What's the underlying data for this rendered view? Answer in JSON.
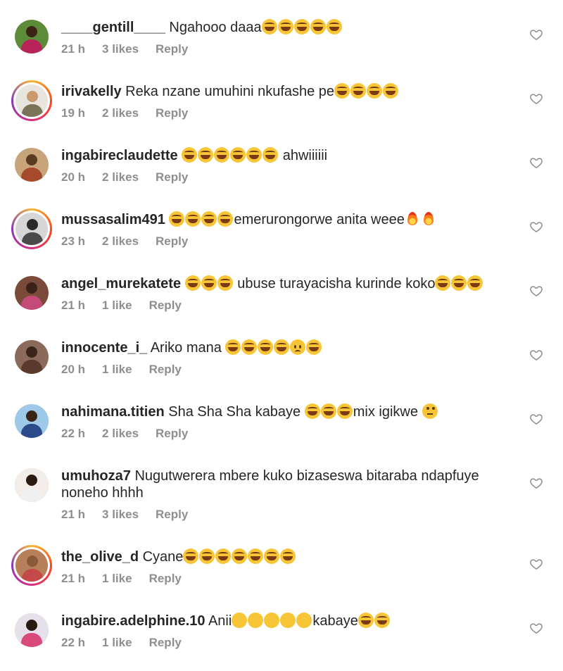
{
  "comments": [
    {
      "user": "____gentill____",
      "segments": [
        {
          "t": " Ngahooo daaa"
        },
        {
          "e": "laugh",
          "n": 5
        }
      ],
      "time": "21 h",
      "likes": "3 likes",
      "reply": "Reply",
      "ring": false,
      "avatar": {
        "bg": "#5c8b3a",
        "head": "#3a2416",
        "body": "#b8245a"
      }
    },
    {
      "user": "irivakelly",
      "segments": [
        {
          "t": " Reka nzane umuhini nkufashe pe"
        },
        {
          "e": "laugh",
          "n": 4
        }
      ],
      "time": "19 h",
      "likes": "2 likes",
      "reply": "Reply",
      "ring": true,
      "avatar": {
        "bg": "#e8e4de",
        "head": "#c89a6c",
        "body": "#7a7458"
      }
    },
    {
      "user": "ingabireclaudette",
      "segments": [
        {
          "t": " "
        },
        {
          "e": "laugh",
          "n": 6
        },
        {
          "t": " ahwiiiiii"
        }
      ],
      "time": "20 h",
      "likes": "2 likes",
      "reply": "Reply",
      "ring": false,
      "avatar": {
        "bg": "#c8a47a",
        "head": "#5a3b22",
        "body": "#a54a2a"
      }
    },
    {
      "user": "mussasalim491",
      "segments": [
        {
          "t": " "
        },
        {
          "e": "laugh",
          "n": 4
        },
        {
          "t": "emerurongorwe anita weee"
        },
        {
          "e": "fire",
          "n": 2
        }
      ],
      "time": "23 h",
      "likes": "2 likes",
      "reply": "Reply",
      "ring": true,
      "avatar": {
        "bg": "#d6d6d6",
        "head": "#2a2a2a",
        "body": "#4a4a4a"
      }
    },
    {
      "user": "angel_murekatete",
      "segments": [
        {
          "t": " "
        },
        {
          "e": "laugh",
          "n": 3
        },
        {
          "t": " ubuse turayacisha kurinde koko"
        },
        {
          "e": "laugh",
          "n": 3
        }
      ],
      "time": "21 h",
      "likes": "1 like",
      "reply": "Reply",
      "ring": false,
      "avatar": {
        "bg": "#7a4a3a",
        "head": "#3a2218",
        "body": "#c44a7a"
      }
    },
    {
      "user": "innocente_i_",
      "segments": [
        {
          "t": " Ariko mana "
        },
        {
          "e": "laugh",
          "n": 4
        },
        {
          "e": "worried",
          "n": 1
        },
        {
          "e": "laugh",
          "n": 1
        }
      ],
      "time": "20 h",
      "likes": "1 like",
      "reply": "Reply",
      "ring": false,
      "avatar": {
        "bg": "#8a6a5a",
        "head": "#3b2418",
        "body": "#5a3a2a"
      }
    },
    {
      "user": "nahimana.titien",
      "segments": [
        {
          "t": " Sha Sha Sha kabaye "
        },
        {
          "e": "laugh",
          "n": 3
        },
        {
          "t": "mix igikwe "
        },
        {
          "e": "roll",
          "n": 1
        }
      ],
      "time": "22 h",
      "likes": "2 likes",
      "reply": "Reply",
      "ring": false,
      "avatar": {
        "bg": "#9ec9e8",
        "head": "#3a2418",
        "body": "#2b4a8a"
      }
    },
    {
      "user": "umuhoza7",
      "segments": [
        {
          "t": " Nugutwerera mbere kuko bizaseswa bitaraba ndapfuye noneho hhhh"
        }
      ],
      "time": "21 h",
      "likes": "3 likes",
      "reply": "Reply",
      "ring": false,
      "avatar": {
        "bg": "#f2ede8",
        "head": "#2a1a12",
        "body": "#f0f0f0"
      }
    },
    {
      "user": "the_olive_d",
      "segments": [
        {
          "t": " Cyane"
        },
        {
          "e": "laugh",
          "n": 7
        }
      ],
      "time": "21 h",
      "likes": "1 like",
      "reply": "Reply",
      "ring": true,
      "avatar": {
        "bg": "#b8805a",
        "head": "#8a5a3a",
        "body": "#c44a4a"
      }
    },
    {
      "user": "ingabire.adelphine.10",
      "segments": [
        {
          "t": " Anii"
        },
        {
          "e": "rofl",
          "n": 5
        },
        {
          "t": "kabaye"
        },
        {
          "e": "laugh",
          "n": 2
        }
      ],
      "time": "22 h",
      "likes": "1 like",
      "reply": "Reply",
      "ring": false,
      "avatar": {
        "bg": "#e6e0ea",
        "head": "#2a1a14",
        "body": "#d84a7a"
      }
    }
  ],
  "icons": {
    "like": "heart-outline-icon"
  },
  "colors": {
    "text": "#262626",
    "meta": "#8e8e8e",
    "ring_gradient": [
      "#f7b733",
      "#fc4a1a",
      "#d92e7f",
      "#8a3ab9"
    ]
  }
}
